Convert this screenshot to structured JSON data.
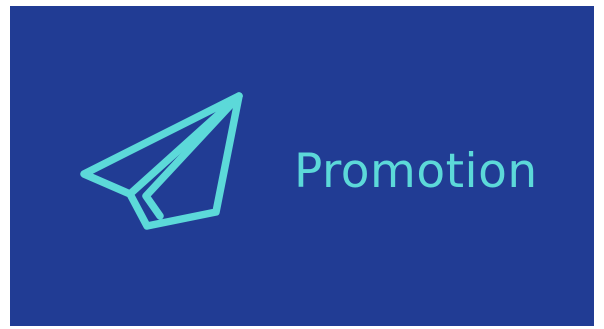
{
  "banner": {
    "label": "Promotion",
    "icon": "paper-plane-icon",
    "colors": {
      "background": "#213c94",
      "accent": "#5cd9d9"
    }
  }
}
